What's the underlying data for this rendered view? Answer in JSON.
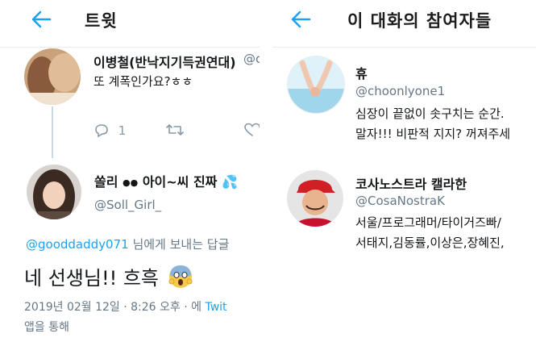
{
  "left": {
    "header_title": "트윗",
    "parent_tweet": {
      "display_name": "이병철(반낙지기득권연대)",
      "handle_partial": "@c",
      "text": "또 계폭인가요?ㅎㅎ",
      "reply_count": "1"
    },
    "main_tweet": {
      "display_name": "쏠리",
      "display_name_tail": "아이~씨 진짜",
      "handle": "@Soll_Girl_",
      "reply_mention": "@gooddaddy071",
      "reply_suffix": " 님에게 보내는 답글",
      "text": "네 선생님!! 흐흑",
      "timestamp": "2019년 02월 12일 · 8:26 오후 · 에 ",
      "via_link": "Twit",
      "via_line2": "앱을 통해"
    }
  },
  "right": {
    "header_title": "이 대화의 참여자들",
    "participants": [
      {
        "name": "휴",
        "handle": "@choonlyone1",
        "bio_line1": "심장이 끝없이 솟구치는 순간.",
        "bio_line2": "말자!!! 비판적 지지? 꺼져주세"
      },
      {
        "name": "코사노스트라 캘라한",
        "handle": "@CosaNostraK",
        "bio_line1": "서울/프로그래머/타이거즈빠/",
        "bio_line2": "서태지,김동률,이상은,장혜진,"
      }
    ]
  },
  "icons": {
    "back": "arrow-left-icon",
    "reply": "reply-icon",
    "retweet": "retweet-icon",
    "like": "heart-icon",
    "scream": "screaming-emoji",
    "droplets": "droplet-emoji"
  },
  "colors": {
    "accent": "#1da1f2",
    "secondary_text": "#657786",
    "divider": "#e6ecf0"
  }
}
